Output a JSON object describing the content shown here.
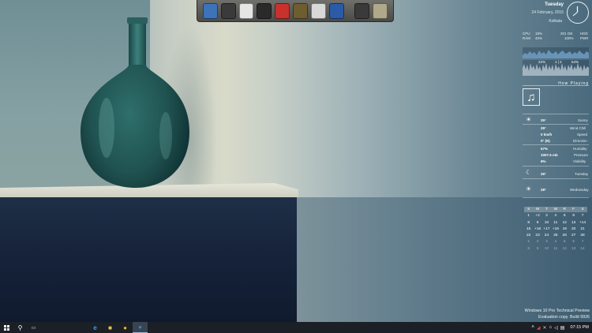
{
  "dock": {
    "icons": [
      {
        "name": "computer-icon",
        "color": "#3d73b8"
      },
      {
        "name": "steam-icon",
        "color": "#3a3a3a"
      },
      {
        "name": "chrome-icon",
        "color": "#e5e5e5"
      },
      {
        "name": "media-icon",
        "color": "#2a2a2a"
      },
      {
        "name": "recycle-icon",
        "color": "#c9312c"
      },
      {
        "name": "gallery-icon",
        "color": "#6e5e2f"
      },
      {
        "name": "info-icon",
        "color": "#d9d9d9"
      },
      {
        "name": "word-icon",
        "color": "#2b5aa8"
      },
      {
        "name": "film-icon",
        "color": "#3a3a3a"
      },
      {
        "name": "drive-icon",
        "color": "#b0a88a"
      }
    ]
  },
  "clock": {
    "day": "Tuesday",
    "date": "24 February, 2015",
    "city": "Kolkata"
  },
  "system": {
    "cpu_label": "CPU",
    "cpu_value": "18%",
    "ram_label": "RAM",
    "ram_value": "40%",
    "hdd_size": "201 GB",
    "hdd_label": "HDD",
    "pwr_value": "100%",
    "pwr_label": "PWR",
    "graph2_left": "22%",
    "graph2_mid": "1 | 2",
    "graph2_right": "54%"
  },
  "now_playing": {
    "title": "How Playing"
  },
  "weather": {
    "current_temp": "25°",
    "condition": "Sunny",
    "wind_chill": "29°",
    "wind_chill_label": "Wind Chill",
    "speed": "0 km/h",
    "speed_label": "Speed",
    "direction": "0° (N)",
    "direction_label": "Direction",
    "humidity": "57%",
    "humidity_label": "Humidity",
    "pressure": "1007.5 mb",
    "pressure_label": "Pressure",
    "visibility": "6%",
    "visibility_label": "Visibility",
    "forecast": [
      {
        "temp": "26°",
        "day": "Tuesday"
      },
      {
        "temp": "28°",
        "day": "Wednesday"
      }
    ]
  },
  "calendar": {
    "headers": [
      "S",
      "M",
      "T",
      "W",
      "R",
      "F",
      "S"
    ],
    "days": [
      "1",
      "+2",
      "3",
      "4",
      "5",
      "6",
      "7",
      "8",
      "9",
      "10",
      "11",
      "12",
      "13",
      "+14",
      "15",
      "+16",
      "+17",
      "+18",
      "19",
      "20",
      "21",
      "22",
      "23",
      "24",
      "25",
      "26",
      "27",
      "28",
      "1",
      "2",
      "3",
      "4",
      "5",
      "6",
      "7",
      "8",
      "9",
      "10",
      "11",
      "12",
      "13",
      "14"
    ],
    "dim_from": 28
  },
  "watermark": {
    "line1": "Windows 10 Pro Technical Preview",
    "line2": "Evaluation copy. Build 9926"
  },
  "taskbar": {
    "time": "07:15 PM"
  }
}
